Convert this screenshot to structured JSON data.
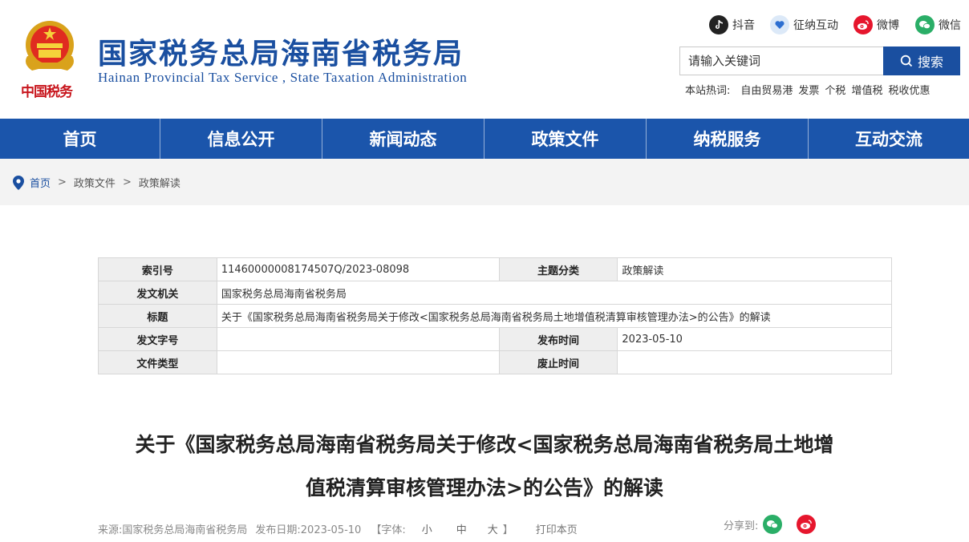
{
  "header": {
    "site_title": "国家税务总局海南省税务局",
    "site_subtitle": "Hainan  Provincial  Tax Service , State Taxation  Administration",
    "emblem_caption": "中国税务",
    "social": {
      "douyin": "抖音",
      "zhengna": "征纳互动",
      "weibo": "微博",
      "weixin": "微信"
    },
    "search": {
      "placeholder": "请输入关键词",
      "button_label": "搜索"
    },
    "hotwords": {
      "label": "本站热词:",
      "items": [
        "自由贸易港",
        "发票",
        "个税",
        "增值税",
        "税收优惠"
      ]
    }
  },
  "nav": {
    "items": [
      "首页",
      "信息公开",
      "新闻动态",
      "政策文件",
      "纳税服务",
      "互动交流"
    ]
  },
  "breadcrumb": {
    "home": "首页",
    "level1": "政策文件",
    "level2": "政策解读",
    "separator": ">"
  },
  "info_table": {
    "index_label": "索引号",
    "index_value": "11460000008174507Q/2023-08098",
    "topic_label": "主题分类",
    "topic_value": "政策解读",
    "issuer_label": "发文机关",
    "issuer_value": "国家税务总局海南省税务局",
    "title_label": "标题",
    "title_value": "关于《国家税务总局海南省税务局关于修改<国家税务总局海南省税务局土地增值税清算审核管理办法>的公告》的解读",
    "docno_label": "发文字号",
    "docno_value": "",
    "pubdate_label": "发布时间",
    "pubdate_value": "2023-05-10",
    "doctype_label": "文件类型",
    "doctype_value": "",
    "expire_label": "废止时间",
    "expire_value": ""
  },
  "article": {
    "title_line1": "关于《国家税务总局海南省税务局关于修改<国家税务总局海南省税务局土地增",
    "title_line2": "值税清算审核管理办法>的公告》的解读"
  },
  "meta": {
    "source": "来源:国家税务总局海南省税务局",
    "date": "发布日期:2023-05-10",
    "font_open": "【字体:",
    "font_small": "小",
    "font_medium": "中",
    "font_large": "大",
    "font_close": "】",
    "print": "打印本页",
    "share_label": "分享到:"
  },
  "colors": {
    "brand_blue": "#1b55ab",
    "title_blue": "#1a4fa0",
    "weibo_red": "#e6162d",
    "wechat_green": "#2aae67"
  }
}
